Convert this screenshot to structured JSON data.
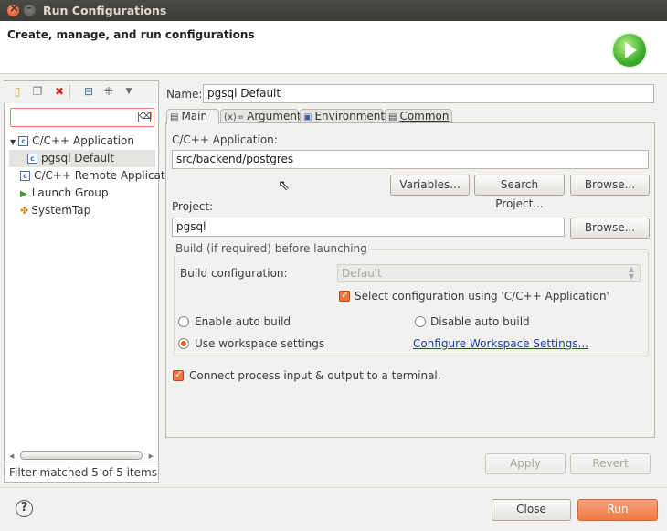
{
  "window": {
    "title": "Run Configurations"
  },
  "banner": {
    "title": "Create, manage, and run configurations",
    "icon": "run-icon"
  },
  "left_panel": {
    "toolbar_icons": [
      "new-launch-config-icon",
      "duplicate-icon",
      "delete-icon",
      "collapse-all-icon",
      "filter-icon",
      "view-menu-icon"
    ],
    "filter": {
      "value": "",
      "placeholder": ""
    },
    "tree": [
      {
        "label": "C/C++ Application",
        "expanded": true,
        "icon": "cpp-app-icon"
      },
      {
        "label": "pgsql Default",
        "selected": true,
        "icon": "cpp-config-icon"
      },
      {
        "label": "C/C++ Remote Applicati",
        "icon": "cpp-remote-icon"
      },
      {
        "label": "Launch Group",
        "icon": "launch-group-icon"
      },
      {
        "label": "SystemTap",
        "icon": "systemtap-icon"
      }
    ],
    "status": "Filter matched 5 of 5 items"
  },
  "config": {
    "name_label": "Name:",
    "name_value": "pgsql Default",
    "tabs": [
      {
        "label": "Main",
        "active": true,
        "icon": "main-tab-icon"
      },
      {
        "label": "Arguments",
        "icon": "arguments-tab-icon"
      },
      {
        "label": "Environment",
        "icon": "environment-tab-icon"
      },
      {
        "label": "Common",
        "icon": "common-tab-icon"
      }
    ],
    "app_label": "C/C++ Application:",
    "app_value": "src/backend/postgres",
    "variables_label": "Variables...",
    "search_project_label": "Search Project...",
    "browse_label": "Browse...",
    "project_label": "Project:",
    "project_value": "pgsql",
    "project_browse_label": "Browse...",
    "build_group_title": "Build (if required) before launching",
    "build_config_label": "Build configuration:",
    "build_config_value": "Default",
    "select_config_label": "Select configuration using 'C/C++ Application'",
    "enable_auto_build": "Enable auto build",
    "disable_auto_build": "Disable auto build",
    "use_workspace_settings": "Use workspace settings",
    "configure_workspace_link": "Configure Workspace Settings...",
    "connect_terminal_label": "Connect process input & output to a terminal.",
    "apply_label": "Apply",
    "revert_label": "Revert"
  },
  "footer": {
    "close_label": "Close",
    "run_label": "Run"
  },
  "colors": {
    "accent": "#ef7a48",
    "link": "#1c3fa0",
    "titlebar": "#3c3b37"
  }
}
